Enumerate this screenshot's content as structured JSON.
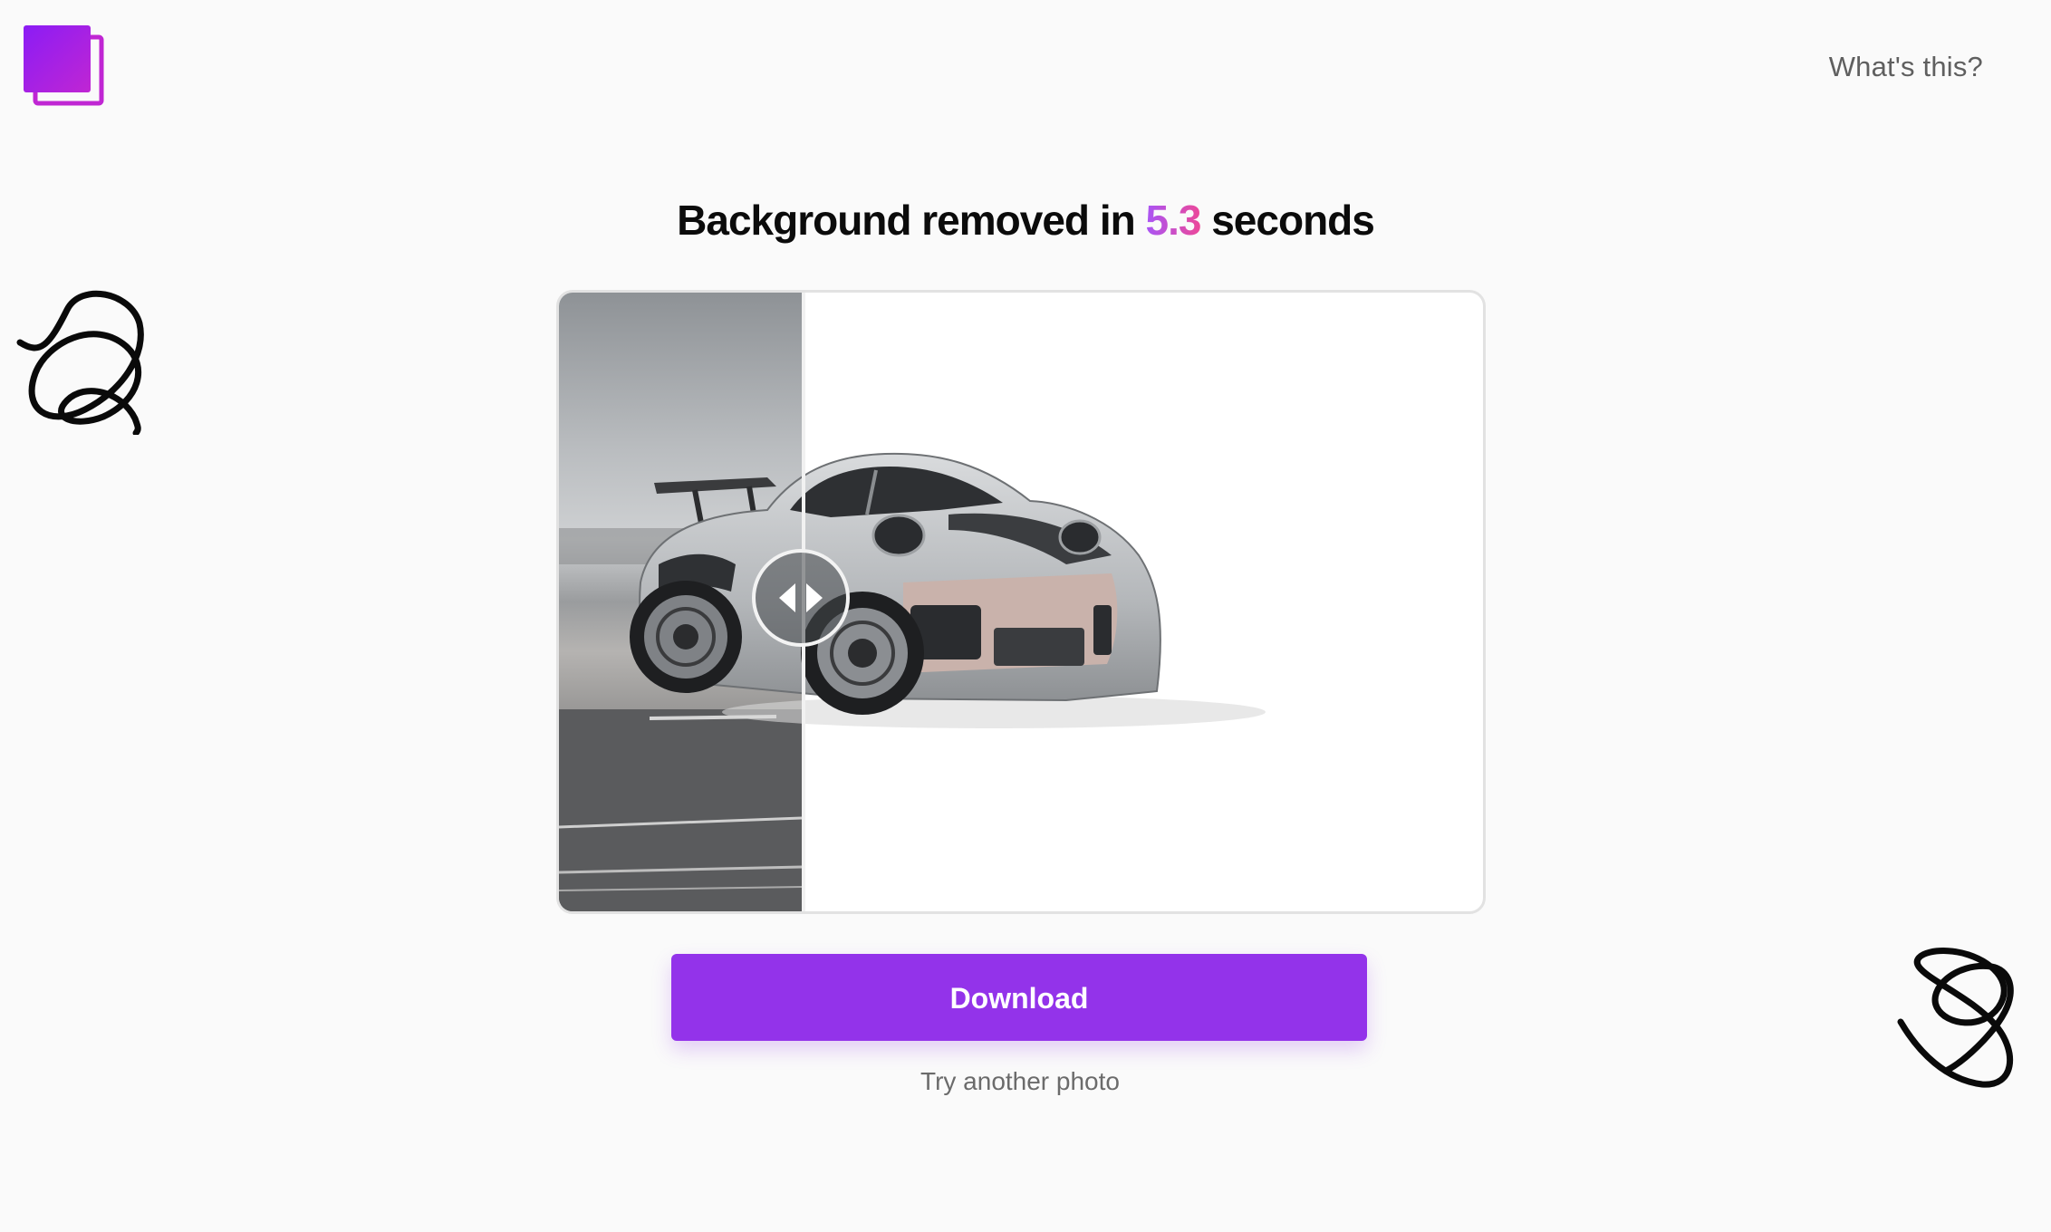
{
  "header": {
    "logo_icon": "stacked-squares-logo",
    "whats_this_label": "What's this?"
  },
  "headline": {
    "prefix": "Background removed in",
    "time": "5.3",
    "suffix": "seconds",
    "time_gradient": [
      "#a855f7",
      "#ec4899"
    ]
  },
  "compare": {
    "image_subject": "grey Porsche sports car",
    "handle_icon": "left-right-arrows-icon"
  },
  "actions": {
    "download_label": "Download",
    "try_another_label": "Try another photo"
  },
  "colors": {
    "accent": "#9333ea",
    "background": "#fafafa"
  },
  "decorations": {
    "left": "scribble-icon",
    "right": "scribble-icon"
  }
}
